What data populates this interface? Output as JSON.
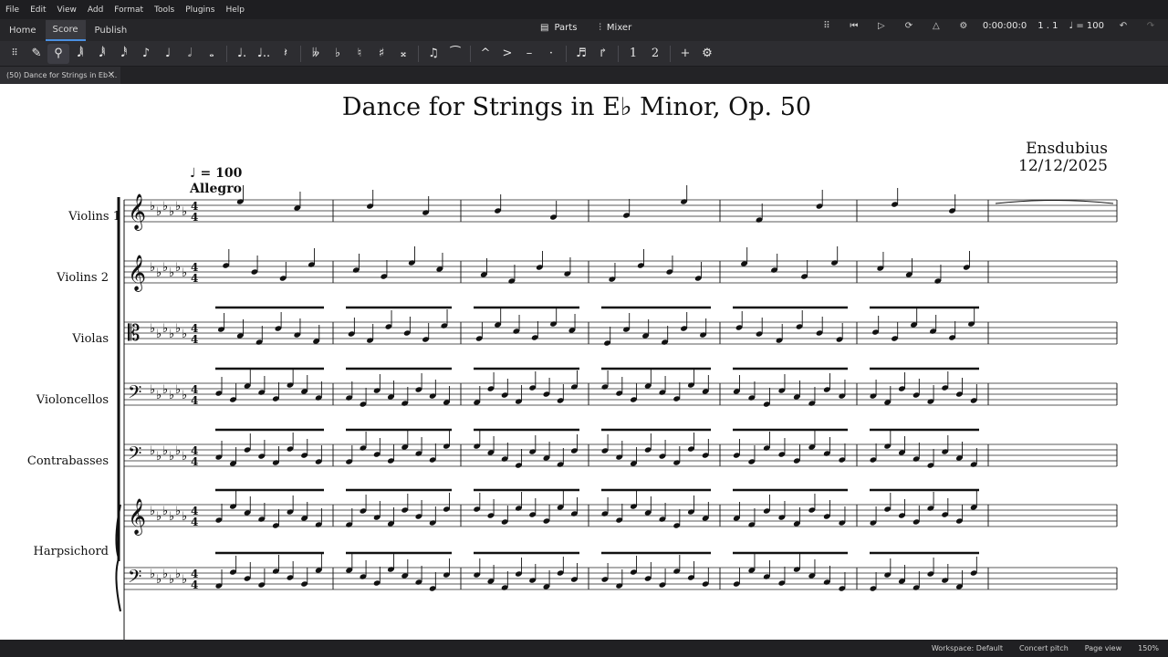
{
  "menu": [
    "File",
    "Edit",
    "View",
    "Add",
    "Format",
    "Tools",
    "Plugins",
    "Help"
  ],
  "tabs": {
    "home": "Home",
    "score": "Score",
    "publish": "Publish"
  },
  "center_tools": {
    "parts": "Parts",
    "mixer": "Mixer"
  },
  "playback": {
    "time": "0:00:00:0",
    "position": "1 . 1",
    "tempo": "♩ = 100"
  },
  "document_tab": "(50) Dance for Strings in Eb ...",
  "score": {
    "title": "Dance for Strings in E♭ Minor, Op. 50",
    "composer": "Ensdubius",
    "date": "12/12/2025",
    "tempo_marking": "♩ = 100",
    "tempo_text": "Allegro",
    "instruments": [
      "Violins 1",
      "Violins 2",
      "Violas",
      "Violoncellos",
      "Contrabasses",
      "Harpsichord"
    ]
  },
  "status": {
    "workspace": "Workspace: Default",
    "concert_pitch": "Concert pitch",
    "page_view": "Page view",
    "zoom": "150%"
  },
  "icons": {
    "note_input": "pencil-icon",
    "parts": "parts-icon",
    "mixer": "mixer-icon"
  },
  "colors": {
    "accent": "#4a90e2",
    "chrome": "#2b2b2f",
    "paper": "#ffffff"
  }
}
